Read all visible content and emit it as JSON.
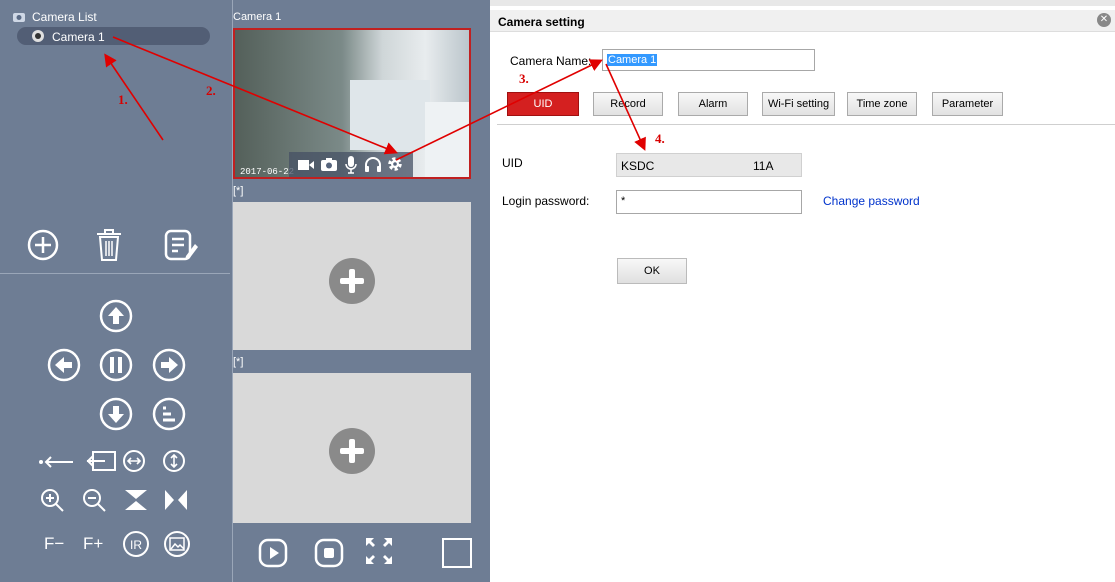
{
  "camera_list": {
    "title": "Camera List",
    "item": "Camera 1"
  },
  "panes": {
    "pane1_title": "Camera 1",
    "pane1_status": "[*]",
    "pane1_timestamp": "2017-06-22",
    "pane2_title": "[*]",
    "pane2_status": "[*]",
    "pane3_title": "[*]",
    "pane3_status": "[*]"
  },
  "dialog": {
    "title": "Camera setting",
    "camera_name_label": "Camera Name:",
    "camera_name_value": "Camera 1",
    "tabs": [
      "UID",
      "Record",
      "Alarm",
      "Wi-Fi setting",
      "Time zone",
      "Parameter"
    ],
    "active_tab": "UID",
    "uid_label": "UID",
    "uid_value_left": "KSDC",
    "uid_value_right": "11A",
    "password_label": "Login password:",
    "password_value": "*",
    "change_password": "Change password",
    "ok": "OK"
  },
  "ptz": {
    "f_minus": "F−",
    "f_plus": "F+"
  },
  "annotations": [
    "1.",
    "2.",
    "3.",
    "4."
  ],
  "colors": {
    "panel": "#6e7d94",
    "active_tab": "#d42020",
    "link": "#0033cc",
    "arrow": "#e00000"
  }
}
